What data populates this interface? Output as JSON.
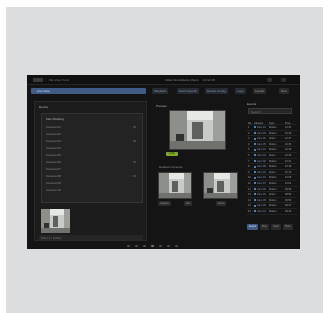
{
  "app": {
    "title": "Video Surveillance Client",
    "menu": "File  View  Tools",
    "clock": "10:42:18",
    "active_tab": "Live View"
  },
  "nav": {
    "tabs": [
      "Playback",
      "Event Search",
      "Device Config",
      "Logs"
    ],
    "actions": [
      "Layout",
      "Tour"
    ]
  },
  "left_panel": {
    "title": "Device",
    "group": "Main Building",
    "items": [
      "Camera 01",
      "Camera 02",
      "Camera 03",
      "Camera 04",
      "Camera 05",
      "Camera 06",
      "Camera 07",
      "Camera 08",
      "Camera 09",
      "Camera 10"
    ],
    "path": "Floor 1 / Lobby"
  },
  "center_panel": {
    "title": "Preview",
    "status": "LIVE",
    "sub_title": "Related Cameras",
    "buttons": [
      "Capture",
      "Rec",
      "Zoom"
    ]
  },
  "right_panel": {
    "title": "Events",
    "search_placeholder": "Search",
    "columns": [
      "No.",
      "Camera",
      "Type",
      "Time"
    ],
    "rows": [
      [
        "1",
        "Cam 01",
        "Motion",
        "10:41"
      ],
      [
        "2",
        "Cam 03",
        "Motion",
        "10:39"
      ],
      [
        "3",
        "Cam 02",
        "Alarm",
        "10:37"
      ],
      [
        "4",
        "Cam 05",
        "Motion",
        "10:33"
      ],
      [
        "5",
        "Cam 01",
        "Motion",
        "10:30"
      ],
      [
        "6",
        "Cam 04",
        "Alarm",
        "10:26"
      ],
      [
        "7",
        "Cam 02",
        "Motion",
        "10:21"
      ],
      [
        "8",
        "Cam 06",
        "Motion",
        "10:18"
      ],
      [
        "9",
        "Cam 03",
        "Alarm",
        "10:12"
      ],
      [
        "10",
        "Cam 01",
        "Motion",
        "10:05"
      ],
      [
        "11",
        "Cam 07",
        "Motion",
        "10:01"
      ],
      [
        "12",
        "Cam 02",
        "Motion",
        "09:58"
      ],
      [
        "13",
        "Cam 04",
        "Alarm",
        "09:54"
      ],
      [
        "14",
        "Cam 05",
        "Motion",
        "09:50"
      ],
      [
        "15",
        "Cam 06",
        "Motion",
        "09:47"
      ],
      [
        "16",
        "Cam 01",
        "Motion",
        "09:43"
      ]
    ],
    "buttons": [
      "Export",
      "Play",
      "Clear",
      "More"
    ]
  },
  "colors": {
    "accent": "#3f5b86",
    "status_live": "#7ea829",
    "screen_bg": "#141414",
    "frame_bg": "#dcdddf"
  }
}
